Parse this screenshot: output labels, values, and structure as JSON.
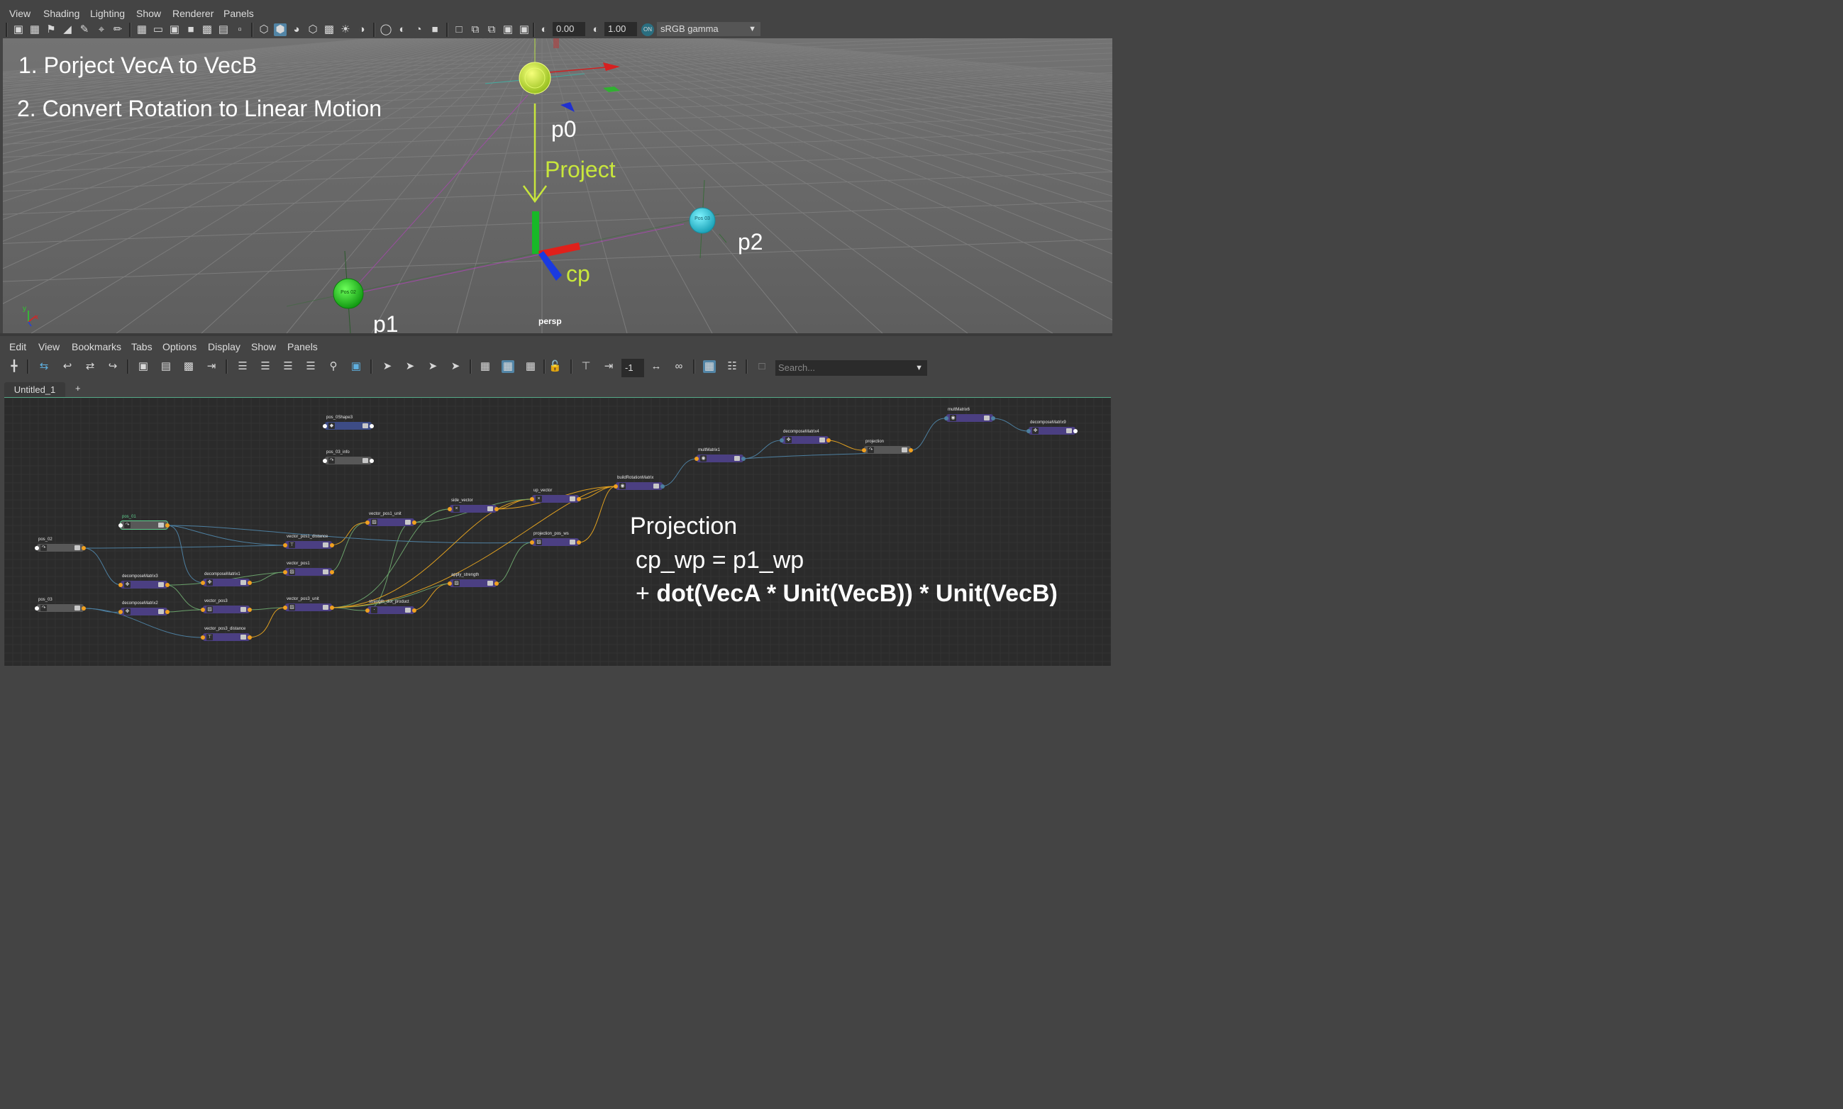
{
  "viewport_panel": {
    "menu": [
      "View",
      "Shading",
      "Lighting",
      "Show",
      "Renderer",
      "Panels"
    ],
    "exposure_value": "0.00",
    "gamma_value": "1.00",
    "color_space": "sRGB gamma",
    "camera_label": "persp",
    "notes": [
      "1. Porject VecA to VecB",
      "2. Convert Rotation to Linear Motion"
    ],
    "labels": {
      "p0": "p0",
      "p1": "p1",
      "p2": "p2",
      "cp": "cp",
      "project": "Project"
    },
    "sphere_labels": {
      "pos02": "Pos 02",
      "pos03": "Pos 03"
    },
    "axis_colors": {
      "x": "#e0201a",
      "y": "#18b828",
      "z": "#1a3ae0",
      "accent": "#c8e63c"
    }
  },
  "node_editor": {
    "menu": [
      "Edit",
      "View",
      "Bookmarks",
      "Tabs",
      "Options",
      "Display",
      "Show",
      "Panels"
    ],
    "depth_value": "-1",
    "search_placeholder": "Search...",
    "tabs": [
      "Untitled_1"
    ],
    "add_tab": "+",
    "nodes": {
      "pos_0Shape3": "pos_0Shape3",
      "pos_03_info": "pos_03_info",
      "pos_01": "pos_01",
      "pos_02": "pos_02",
      "pos_03": "pos_03",
      "decomposeMatrix3": "decomposeMatrix3",
      "decomposeMatrix2": "decomposeMatrix2",
      "decomposeMatrix1": "decomposeMatrix1",
      "vector_pos3": "vector_pos3",
      "vector_pos3_distance": "vector_pos3_distance",
      "vector_pos1_distance": "vector_pos1_distance",
      "vector_pos1": "vector_pos1",
      "vector_pos3_unit": "vector_pos3_unit",
      "vector_pos1_unit": "vector_pos1_unit",
      "strength_dot_product": "strength_dot_product",
      "side_vector": "side_vector",
      "apply_strength": "apply_strength",
      "up_vector": "up_vector",
      "projection_pos_ws": "projection_pos_ws",
      "buildRotationMatrix": "buildRotationMatrix",
      "multMatrix1": "multMatrix1",
      "decomposeMatrix4": "decomposeMatrix4",
      "projection": "projection",
      "multMatrix6": "multMatrix6",
      "decomposeMatrix9": "decomposeMatrix9"
    },
    "annotation": {
      "title": "Projection",
      "line1": "cp_wp = p1_wp",
      "line2_prefix": "+ ",
      "line2_bold": "dot(VecA * Unit(VecB)) * Unit(VecB)"
    }
  }
}
